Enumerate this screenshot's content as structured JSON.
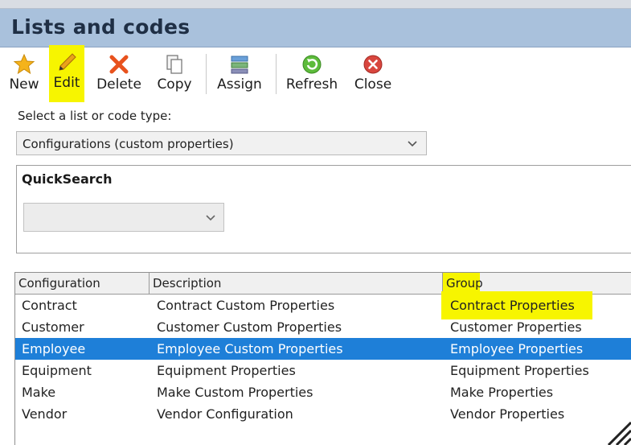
{
  "window": {
    "title": "Lists and codes"
  },
  "toolbar": {
    "new_label": "New",
    "edit_label": "Edit",
    "delete_label": "Delete",
    "copy_label": "Copy",
    "assign_label": "Assign",
    "refresh_label": "Refresh",
    "close_label": "Close"
  },
  "selector": {
    "label": "Select a list or code type:",
    "value": "Configurations (custom properties)"
  },
  "quicksearch": {
    "title": "QuickSearch",
    "value": ""
  },
  "grid": {
    "columns": [
      "Configuration",
      "Description",
      "Group"
    ],
    "rows": [
      [
        "Contract",
        "Contract Custom Properties",
        "Contract Properties"
      ],
      [
        "Customer",
        "Customer Custom Properties",
        "Customer Properties"
      ],
      [
        "Employee",
        "Employee Custom Properties",
        "Employee Properties"
      ],
      [
        "Equipment",
        "Equipment Properties",
        "Equipment Properties"
      ],
      [
        "Make",
        "Make Custom Properties",
        "Make Properties"
      ],
      [
        "Vendor",
        "Vendor Configuration",
        "Vendor Properties"
      ]
    ],
    "selected_row": "Employee"
  },
  "colors": {
    "title_bar": "#a9c1dc",
    "selection": "#1e7fd8",
    "highlight": "#f7f500"
  },
  "icons": [
    "star-icon",
    "pencil-icon",
    "x-icon",
    "copy-icon",
    "assign-icon",
    "refresh-icon",
    "close-circle-icon",
    "chevron-down-icon"
  ]
}
